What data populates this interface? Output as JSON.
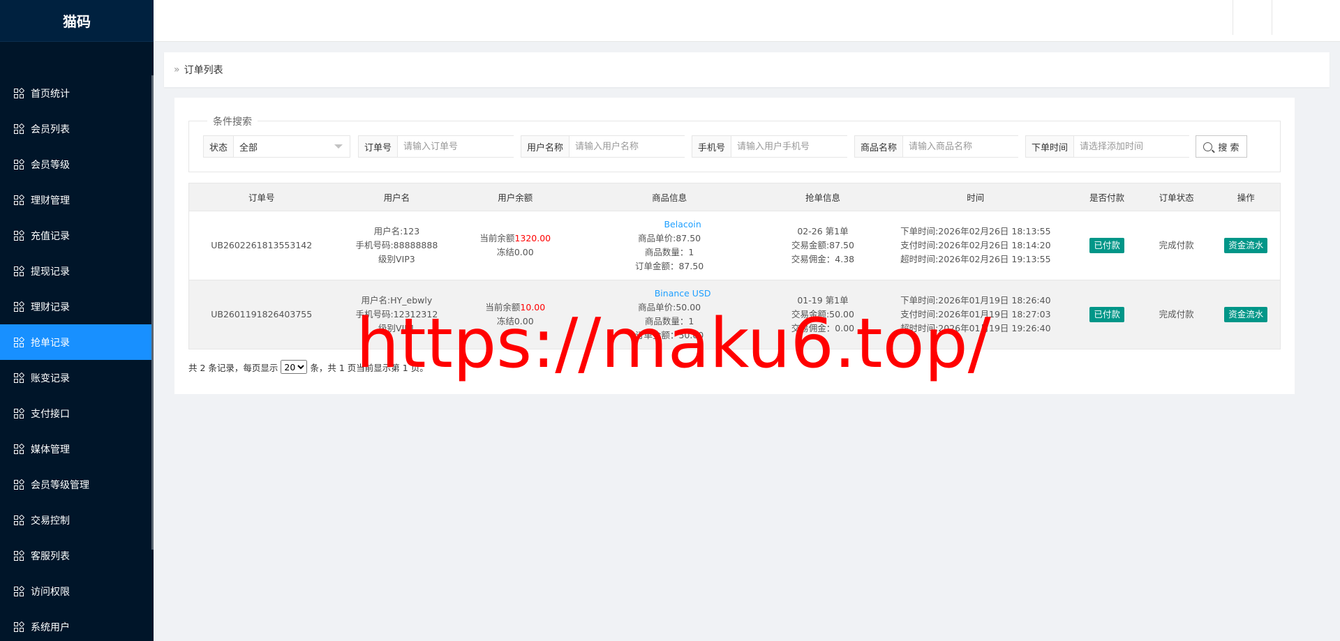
{
  "app": {
    "brand": "猫码"
  },
  "sidebar": {
    "items": [
      {
        "label": "首页统计",
        "active": false
      },
      {
        "label": "会员列表",
        "active": false
      },
      {
        "label": "会员等级",
        "active": false
      },
      {
        "label": "理财管理",
        "active": false
      },
      {
        "label": "充值记录",
        "active": false
      },
      {
        "label": "提现记录",
        "active": false
      },
      {
        "label": "理财记录",
        "active": false
      },
      {
        "label": "抢单记录",
        "active": true
      },
      {
        "label": "账变记录",
        "active": false
      },
      {
        "label": "支付接口",
        "active": false
      },
      {
        "label": "媒体管理",
        "active": false
      },
      {
        "label": "会员等级管理",
        "active": false
      },
      {
        "label": "交易控制",
        "active": false
      },
      {
        "label": "客服列表",
        "active": false
      },
      {
        "label": "访问权限",
        "active": false
      },
      {
        "label": "系统用户",
        "active": false
      }
    ]
  },
  "breadcrumb": {
    "title": "订单列表"
  },
  "search": {
    "legend": "条件搜索",
    "status_label": "状态",
    "status_value": "全部",
    "order_label": "订单号",
    "order_placeholder": "请输入订单号",
    "user_label": "用户名称",
    "user_placeholder": "请输入用户名称",
    "phone_label": "手机号",
    "phone_placeholder": "请输入用户手机号",
    "goods_label": "商品名称",
    "goods_placeholder": "请输入商品名称",
    "time_label": "下单时间",
    "time_placeholder": "请选择添加时间",
    "button": "搜 索"
  },
  "table": {
    "headers": [
      "订单号",
      "用户名",
      "用户余额",
      "商品信息",
      "抢单信息",
      "时间",
      "是否付款",
      "订单状态",
      "操作"
    ],
    "rows": [
      {
        "order_no": "UB2602261813553142",
        "user_name": "用户名:123",
        "user_phone": "手机号码:88888888",
        "user_level": "级别VIP3",
        "balance_label": "当前余额",
        "balance_value": "1320.00",
        "frozen": "冻结0.00",
        "goods_name": "Belacoin",
        "goods_price": "商品单价:87.50",
        "goods_qty": "商品数量：1",
        "goods_amount": "订单金额：87.50",
        "grab_date": "02-26 第1单",
        "grab_amount": "交易金额:87.50",
        "grab_commission": "交易佣金：4.38",
        "time_order": "下单时间:2026年02月26日 18:13:55",
        "time_pay": "支付时间:2026年02月26日 18:14:20",
        "time_timeout": "超时时间:2026年02月26日 19:13:55",
        "paid": "已付款",
        "status": "完成付款",
        "action": "资金流水"
      },
      {
        "order_no": "UB2601191826403755",
        "user_name": "用户名:HY_ebwly",
        "user_phone": "手机号码:12312312",
        "user_level": "级别VIP1",
        "balance_label": "当前余额",
        "balance_value": "10.00",
        "frozen": "冻结0.00",
        "goods_name": "Binance USD",
        "goods_price": "商品单价:50.00",
        "goods_qty": "商品数量：1",
        "goods_amount": "订单金额：50.00",
        "grab_date": "01-19 第1单",
        "grab_amount": "交易金额:50.00",
        "grab_commission": "交易佣金：0.00",
        "time_order": "下单时间:2026年01月19日 18:26:40",
        "time_pay": "支付时间:2026年01月19日 18:27:03",
        "time_timeout": "超时时间:2026年01月19日 19:26:40",
        "paid": "已付款",
        "status": "完成付款",
        "action": "资金流水"
      }
    ]
  },
  "pager": {
    "prefix": "共 2 条记录，每页显示",
    "page_size": "20",
    "suffix": "条，共 1 页当前显示第 1 页。"
  },
  "watermark": "https://maku6.top/"
}
